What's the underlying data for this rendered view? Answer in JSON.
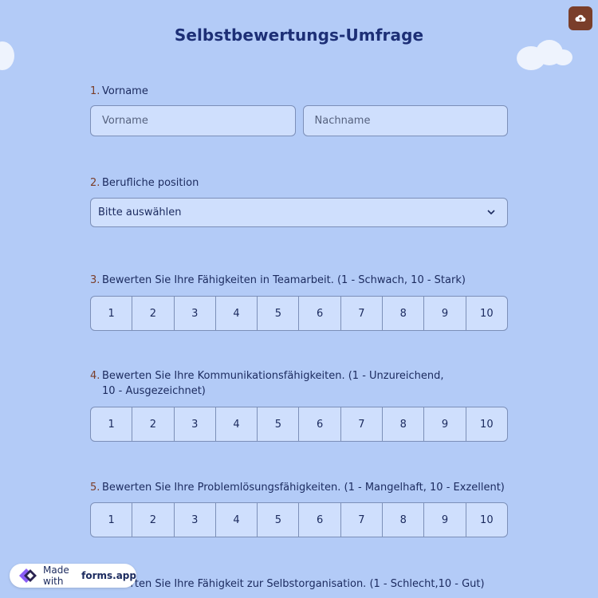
{
  "form": {
    "title": "Selbstbewertungs-Umfrage"
  },
  "q1": {
    "number": "1.",
    "label": "Vorname",
    "first_placeholder": "Vorname",
    "last_placeholder": "Nachname"
  },
  "q2": {
    "number": "2.",
    "label": "Berufliche position",
    "selected": "Bitte auswählen"
  },
  "q3": {
    "number": "3.",
    "label": "Bewerten Sie Ihre Fähigkeiten in Teamarbeit. (1 - Schwach, 10 - Stark)"
  },
  "q4": {
    "number": "4.",
    "label": "Bewerten Sie Ihre Kommunikationsfähigkeiten. (1 - Unzureichend, 10 - Ausgezeichnet)"
  },
  "q5": {
    "number": "5.",
    "label": "Bewerten Sie Ihre Problemlösungsfähigkeiten. (1 - Mangelhaft, 10 - Exzellent)"
  },
  "q6": {
    "label": "Bewerten Sie Ihre Fähigkeit zur Selbstorganisation. (1 - Schlecht,10 - Gut)"
  },
  "scale": [
    "1",
    "2",
    "3",
    "4",
    "5",
    "6",
    "7",
    "8",
    "9",
    "10"
  ],
  "badge": {
    "made_with": "Made with",
    "brand": "forms.app"
  },
  "colors": {
    "background": "#b3cbf7",
    "accent": "#7a3e2a",
    "title": "#1d2f76"
  },
  "icons": {
    "upload": "cloud-upload-icon",
    "chevron": "chevron-down-icon",
    "logo": "formsapp-logo-icon"
  }
}
